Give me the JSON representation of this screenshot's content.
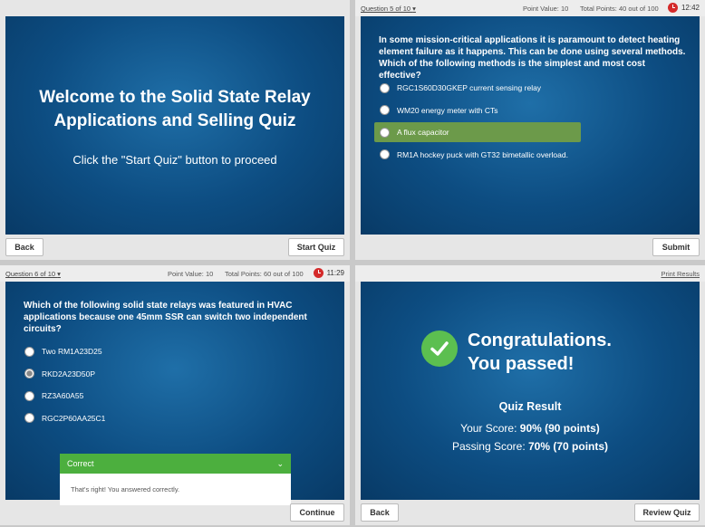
{
  "panel1": {
    "title_line1": "Welcome to the Solid State Relay",
    "title_line2": "Applications and Selling Quiz",
    "subtitle": "Click the \"Start Quiz\" button to proceed",
    "back": "Back",
    "start": "Start Quiz"
  },
  "panel2": {
    "question_num": "Question 5 of 10",
    "point_value": "Point Value: 10",
    "total_points": "Total Points: 40 out of 100",
    "timer": "12:42",
    "question": "In some mission-critical applications it is paramount to detect heating element failure as it happens.  This can be done using several methods. Which of the following methods is the simplest and most cost effective?",
    "options": [
      "RGC1S60D30GKEP current sensing relay",
      "WM20 energy meter with CTs",
      "A flux capacitor",
      "RM1A hockey puck with GT32 bimetallic overload."
    ],
    "submit": "Submit"
  },
  "panel3": {
    "question_num": "Question 6 of 10",
    "point_value": "Point Value: 10",
    "total_points": "Total Points: 60 out of 100",
    "timer": "11:29",
    "question": "Which of the following solid state relays was featured in HVAC applications because one 45mm SSR can switch two independent circuits?",
    "options": [
      "Two RM1A23D25",
      "RKD2A23D50P",
      "RZ3A60A55",
      "RGC2P60AA25C1"
    ],
    "feedback_title": "Correct",
    "feedback_text": "That's right! You answered correctly.",
    "continue": "Continue"
  },
  "panel4": {
    "print": "Print Results",
    "congrats_line1": "Congratulations.",
    "congrats_line2": "You passed!",
    "result_title": "Quiz Result",
    "your_score_label": "Your Score: ",
    "your_score": "90% (90 points)",
    "passing_label": "Passing Score: ",
    "passing_score": "70% (70 points)",
    "back": "Back",
    "review": "Review Quiz"
  }
}
